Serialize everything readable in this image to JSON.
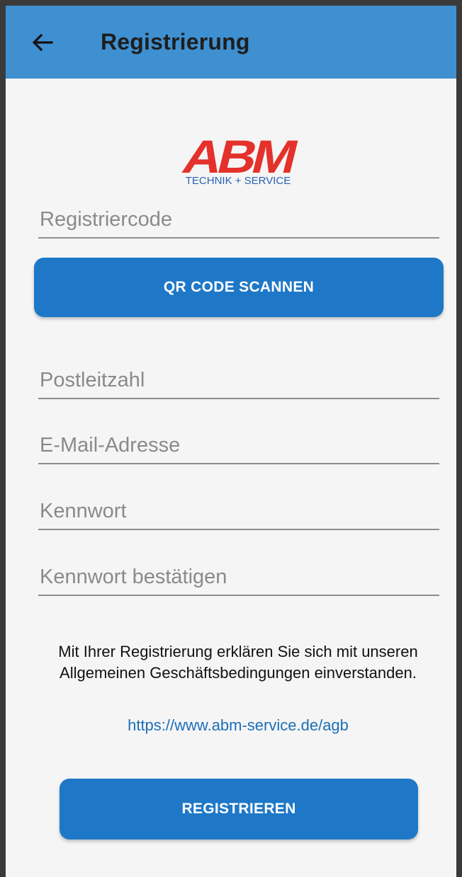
{
  "colors": {
    "appbar": "#3f90d1",
    "accent": "#1e78c7",
    "background": "#f5f5f5",
    "brand_red": "#e4312b",
    "brand_blue": "#2a63b3",
    "link": "#1e6fb8"
  },
  "header": {
    "back_icon": "arrow-left-icon",
    "title": "Registrierung"
  },
  "logo": {
    "letters": "ABM",
    "tagline": "TECHNIK + SERVICE"
  },
  "form": {
    "registration_code": {
      "placeholder": "Registriercode",
      "value": ""
    },
    "scan_button_label": "QR CODE SCANNEN",
    "postal_code": {
      "placeholder": "Postleitzahl",
      "value": ""
    },
    "email": {
      "placeholder": "E-Mail-Adresse",
      "value": ""
    },
    "password": {
      "placeholder": "Kennwort",
      "value": ""
    },
    "password_confirm": {
      "placeholder": "Kennwort bestätigen",
      "value": ""
    }
  },
  "terms": {
    "text": "Mit Ihrer Registrierung erklären Sie sich mit unseren Allgemeinen Geschäftsbedingungen einverstanden.",
    "link": "https://www.abm-service.de/agb"
  },
  "submit_label": "REGISTRIEREN"
}
